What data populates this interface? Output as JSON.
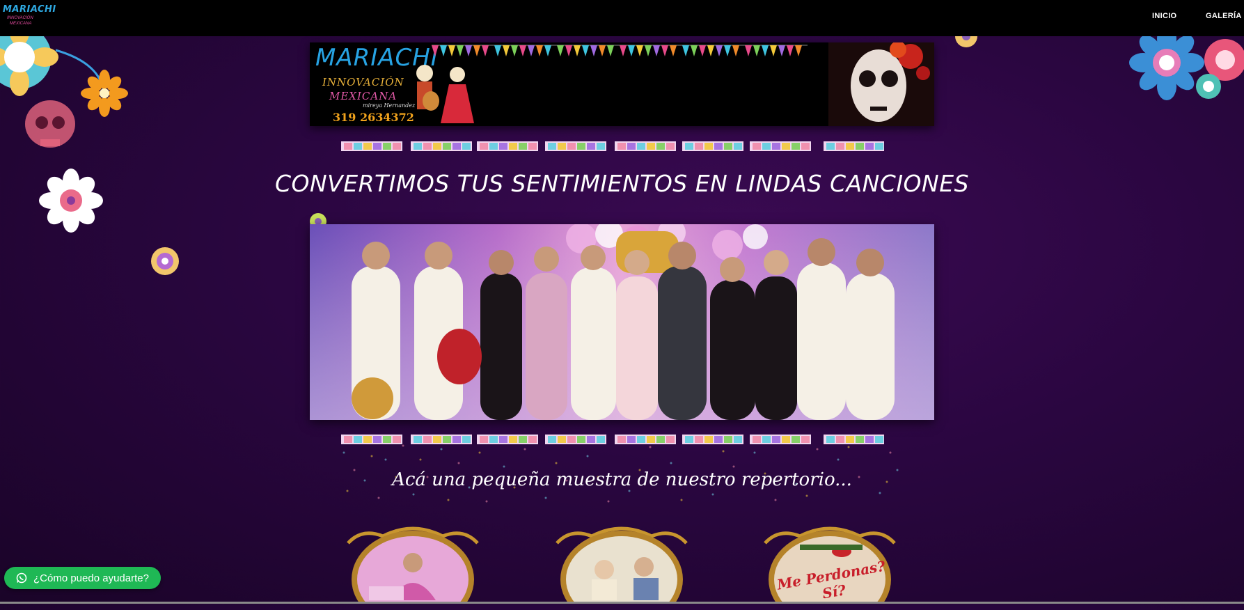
{
  "nav": {
    "logo_lines": [
      "MARIACHI",
      "INNOVACIÓN",
      "MEXICANA"
    ],
    "links": [
      "INICIO",
      "GALERÍA"
    ]
  },
  "banner": {
    "title": "MARIACHI",
    "subtitle_1": "INNOVACIÓN",
    "subtitle_2": "MEXICANA",
    "signature": "mireya Hernandez",
    "phone": "319 2634372"
  },
  "headline": "CONVERTIMOS TUS SENTIMIENTOS EN LINDAS CANCIONES",
  "repertoire_heading": "Acá una pequeña muestra de nuestro repertorio...",
  "repertoire_items": [
    {
      "caption": ""
    },
    {
      "caption": ""
    },
    {
      "caption": "Me Perdonas? Sí?"
    }
  ],
  "whatsapp": {
    "label": "¿Cómo puedo ayudarte?",
    "icon": "whatsapp-icon"
  },
  "colors": {
    "background": "#2a0640",
    "topbar": "#000000",
    "whatsapp_green": "#1fb855",
    "logo_blue": "#27a3e3",
    "logo_pink": "#e35aa8",
    "logo_gold": "#e8b13a"
  }
}
